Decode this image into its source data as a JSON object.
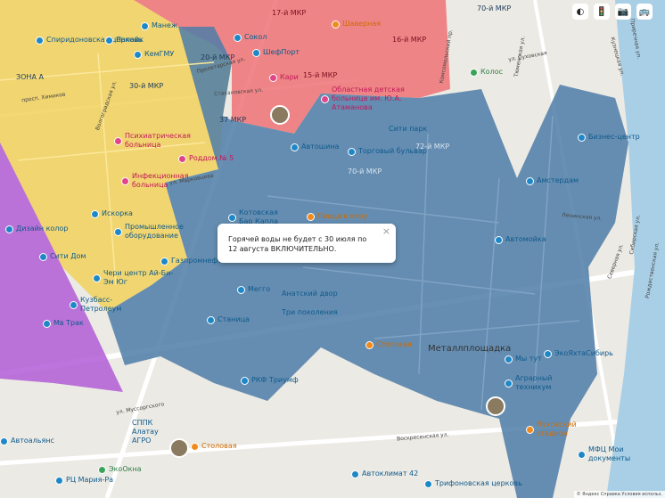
{
  "map": {
    "popup_text": "Горячей воды не будет с 30 июля по 12 августа ВКЛЮЧИТЕЛЬНО.",
    "popup_close": "×",
    "colors": {
      "yellow_zone": "#f2d15c",
      "red_zone": "#ef7275",
      "purple_zone": "#b15cd6",
      "blue_zone": "#4e7da8"
    },
    "district": "Металлплощадка",
    "pois": [
      {
        "label": "Манеж",
        "style": "blue"
      },
      {
        "label": "Спиридоновская церковь",
        "style": "blue"
      },
      {
        "label": "Палайк",
        "style": "blue"
      },
      {
        "label": "КемГМУ",
        "style": "blue"
      },
      {
        "label": "Сокол",
        "style": "blue"
      },
      {
        "label": "ШефПорт",
        "style": "blue"
      },
      {
        "label": "Кари",
        "style": "pink"
      },
      {
        "label": "Областная детская больница им. Ю.А. Атаманова",
        "style": "pink"
      },
      {
        "label": "Колос",
        "style": "green"
      },
      {
        "label": "Психиатрическая больница",
        "style": "pink"
      },
      {
        "label": "Роддом № 5",
        "style": "pink"
      },
      {
        "label": "Инфекционная больница",
        "style": "pink"
      },
      {
        "label": "Автошина",
        "style": "blue"
      },
      {
        "label": "Торговый бульвар",
        "style": "blue"
      },
      {
        "label": "Искорка",
        "style": "blue"
      },
      {
        "label": "Промышленное оборудование",
        "style": "blue"
      },
      {
        "label": "Дизайн колор",
        "style": "blue"
      },
      {
        "label": "Сити Дом",
        "style": "blue"
      },
      {
        "label": "Газпромнефть",
        "style": "blue"
      },
      {
        "label": "Чери центр Ай-Би-Эм Юг",
        "style": "blue"
      },
      {
        "label": "Кузбасс-Петролеум",
        "style": "blue"
      },
      {
        "label": "Мегго",
        "style": "blue"
      },
      {
        "label": "Мв Трак",
        "style": "blue"
      },
      {
        "label": "Станица",
        "style": "blue"
      },
      {
        "label": "РКФ Триумф",
        "style": "blue"
      },
      {
        "label": "Столовая",
        "style": "orange"
      },
      {
        "label": "Амстердам",
        "style": "blue"
      },
      {
        "label": "Автомойка",
        "style": "blue"
      },
      {
        "label": "Мы тут",
        "style": "blue"
      },
      {
        "label": "ЭкоЯхтаСибирь",
        "style": "blue"
      },
      {
        "label": "Аграрный техникум",
        "style": "blue"
      },
      {
        "label": "Пуховский стадион",
        "style": "orange"
      },
      {
        "label": "МФЦ Мои документы",
        "style": "blue"
      },
      {
        "label": "Автоклимат 42",
        "style": "blue"
      },
      {
        "label": "Трифоновская церковь",
        "style": "blue"
      },
      {
        "label": "Автоальянс",
        "style": "blue"
      },
      {
        "label": "ЭкоОкна",
        "style": "green"
      },
      {
        "label": "РЦ Мария-Ра",
        "style": "blue"
      },
      {
        "label": "Столовая",
        "style": "orange"
      },
      {
        "label": "СППК Алатау АГРО",
        "style": "blue"
      },
      {
        "label": "Шаверная",
        "style": "orange"
      },
      {
        "label": "Бизнес-центр",
        "style": "blue"
      },
      {
        "label": "Пицца в кеоу",
        "style": "orange"
      },
      {
        "label": "Котовская Бар Капла",
        "style": "blue"
      },
      {
        "label": "Анатский двор",
        "style": "blue"
      },
      {
        "label": "Три поколения",
        "style": "blue"
      },
      {
        "label": "Сити парк",
        "style": "blue"
      }
    ],
    "streets": [
      "просп. Химиков",
      "Волгоградская ул.",
      "ул. Марковцева",
      "Пролетарская ул.",
      "Стахановская ул.",
      "ул. Муссоргского",
      "Воскресенская ул.",
      "Тюменская ул.",
      "Комсомольский пр.",
      "ул. Суховская",
      "Приречная ул.",
      "Кузнецкая ул.",
      "Ленинская ул.",
      "Рождественская ул.",
      "Сибирская ул.",
      "Северная ул."
    ],
    "microdistricts": [
      "30-й МКР",
      "15-й МКР",
      "16-й МКР",
      "17-й МКР",
      "20-й МКР",
      "70-й МКР",
      "70-й МКР",
      "72-й МКР",
      "ЗОНА А",
      "37 МКР"
    ],
    "attribution": "© Яндекс  Справка  Условия использ.",
    "tools": {
      "layers": "◐",
      "traffic": "🚦",
      "photo": "📷",
      "transit": "🚌"
    }
  }
}
